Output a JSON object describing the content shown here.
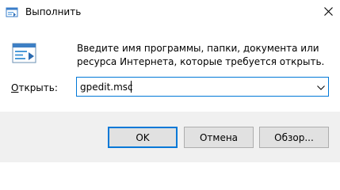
{
  "window": {
    "title": "Выполнить"
  },
  "dialog": {
    "description": "Введите имя программы, папки, документа или ресурса Интернета, которые требуется открыть.",
    "open_label": "Открыть:",
    "open_label_access_key": "О",
    "open_label_rest": "ткрыть:",
    "input_value": "gpedit.msc"
  },
  "buttons": {
    "ok": "OK",
    "cancel": "Отмена",
    "browse": "Обзор..."
  },
  "icons": {
    "title_icon": "run-app-icon",
    "dialog_icon": "run-window-icon",
    "close": "close-icon",
    "dropdown": "chevron-down-icon"
  },
  "colors": {
    "accent": "#0078d7",
    "footer_bg": "#f0f0f0",
    "button_bg": "#e1e1e1"
  }
}
